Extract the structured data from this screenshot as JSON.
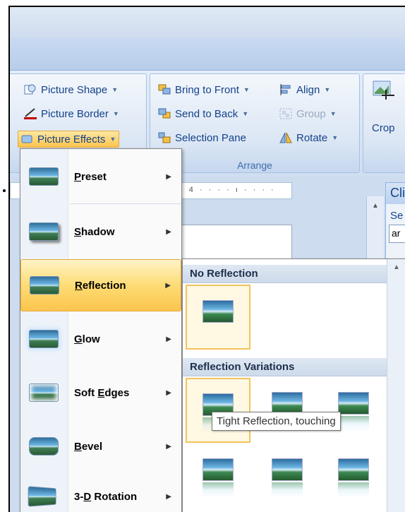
{
  "ribbon": {
    "adjust": {
      "picture_shape": "Picture Shape",
      "picture_border": "Picture Border",
      "picture_effects": "Picture Effects"
    },
    "arrange": {
      "bring_to_front": "Bring to Front",
      "send_to_back": "Send to Back",
      "selection_pane": "Selection Pane",
      "align": "Align",
      "group": "Group",
      "rotate": "Rotate",
      "label": "Arrange"
    },
    "size": {
      "crop": "Crop"
    }
  },
  "document": {
    "ruler_text": "· 4 · · · · ı · · · ·"
  },
  "clip_pane": {
    "title": "Cli",
    "search_label": "Se",
    "input_value": "ar"
  },
  "effects_menu": {
    "items": [
      {
        "label": "Preset",
        "underline": "P"
      },
      {
        "label": "Shadow",
        "underline": "S"
      },
      {
        "label": "Reflection",
        "underline": "R"
      },
      {
        "label": "Glow",
        "underline": "G"
      },
      {
        "label": "Soft Edges",
        "underline": "E"
      },
      {
        "label": "Bevel",
        "underline": "B"
      },
      {
        "label": "3-D Rotation",
        "underline": "D"
      }
    ],
    "selected": "Reflection"
  },
  "reflection_submenu": {
    "no_reflection_header": "No Reflection",
    "variations_header": "Reflection Variations",
    "tooltip": "Tight Reflection, touching"
  }
}
